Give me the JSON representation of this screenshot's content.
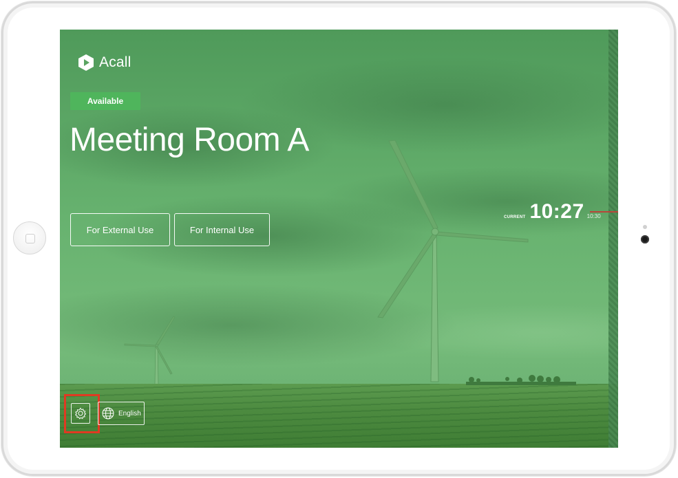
{
  "app": {
    "logo_text": "Acall"
  },
  "room": {
    "status": "Available",
    "name": "Meeting Room A"
  },
  "actions": {
    "external_label": "For External Use",
    "internal_label": "For Internal Use"
  },
  "clock": {
    "label": "CURRENT",
    "time": "10:27",
    "next_tick": "10:30"
  },
  "footer": {
    "language_label": "English"
  },
  "icons": {
    "logo": "acall-logo-icon",
    "settings": "gear-icon",
    "language": "globe-icon"
  },
  "colors": {
    "overlay_green": "#5aa462",
    "status_green": "#4fb55c",
    "highlight_red": "#e03a22",
    "timeline_red": "#b9463a"
  }
}
